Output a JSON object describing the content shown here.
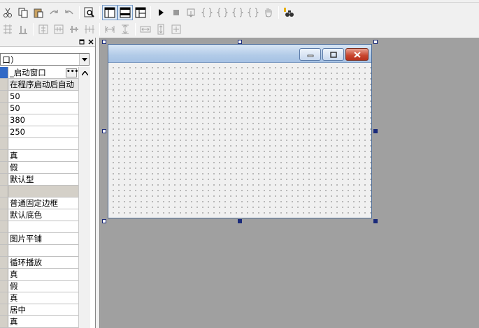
{
  "toolbar1": {
    "buttons": [
      {
        "name": "cut-icon"
      },
      {
        "name": "copy-icon"
      },
      {
        "name": "paste-icon"
      },
      {
        "name": "redo-icon"
      },
      {
        "name": "undo-icon"
      },
      {
        "name": "find-icon"
      },
      {
        "name": "layout-left-panel-icon"
      },
      {
        "name": "layout-top-panel-icon"
      },
      {
        "name": "layout-split-panel-icon"
      },
      {
        "name": "run-icon"
      },
      {
        "name": "stop-icon"
      },
      {
        "name": "step-into-icon"
      },
      {
        "name": "brace-icon"
      },
      {
        "name": "brace-icon"
      },
      {
        "name": "brace-icon"
      },
      {
        "name": "brace-icon"
      },
      {
        "name": "hand-icon"
      },
      {
        "name": "binoculars-icon"
      }
    ]
  },
  "panel": {
    "combo_text": "口）",
    "selected_value": "_启动窗口",
    "ellipsis": "•••",
    "rows": [
      "_启动窗口",
      "在程序启动后自动",
      "50",
      "50",
      "380",
      "250",
      "",
      "真",
      "假",
      "默认型",
      "",
      "普通固定边框",
      "默认底色",
      "",
      "图片平铺",
      "",
      "循环播放",
      "真",
      "假",
      "真",
      "居中",
      "真"
    ]
  },
  "colors": {
    "design_background": "#a0a0a0",
    "selection_accent": "#3169c6"
  }
}
